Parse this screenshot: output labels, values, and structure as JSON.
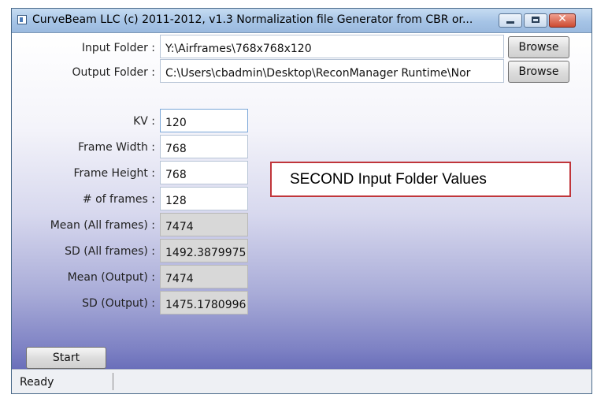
{
  "window": {
    "title": "CurveBeam LLC (c) 2011-2012, v1.3 Normalization file Generator from CBR or...",
    "controls": {
      "minimize": "minimize",
      "maximize": "maximize",
      "close": "✕"
    }
  },
  "folders": {
    "input_label": "Input Folder :",
    "input_value": "Y:\\Airframes\\768x768x120",
    "output_label": "Output Folder :",
    "output_value": "C:\\Users\\cbadmin\\Desktop\\ReconManager Runtime\\Nor",
    "browse_label": "Browse"
  },
  "params": [
    {
      "label": "KV :",
      "value": "120",
      "editable": true
    },
    {
      "label": "Frame Width :",
      "value": "768",
      "editable": true
    },
    {
      "label": "Frame Height :",
      "value": "768",
      "editable": true
    },
    {
      "label": "# of frames :",
      "value": "128",
      "editable": true
    },
    {
      "label": "Mean (All frames) :",
      "value": "7474",
      "editable": false
    },
    {
      "label": "SD (All frames) :",
      "value": "1492.3879975",
      "editable": false
    },
    {
      "label": "Mean (Output) :",
      "value": "7474",
      "editable": false
    },
    {
      "label": "SD (Output) :",
      "value": "1475.1780996",
      "editable": false
    }
  ],
  "annotation": {
    "text": "SECOND Input Folder Values",
    "border_color": "#c0353a"
  },
  "start_button": {
    "label": "Start"
  },
  "status": {
    "text": "Ready"
  },
  "colors": {
    "title_bar": "#a6c4e6",
    "client_bottom": "#6a6fba",
    "readonly_field": "#d8d8d8"
  }
}
